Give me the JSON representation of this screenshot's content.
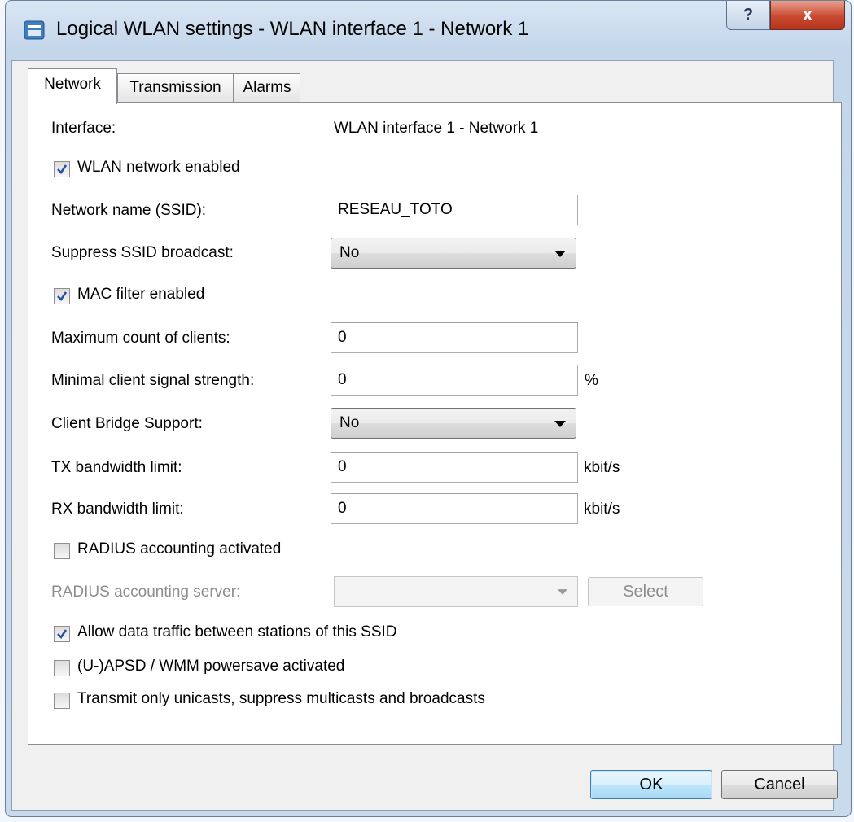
{
  "window": {
    "title": "Logical WLAN settings - WLAN interface 1 - Network 1",
    "help_label": "?",
    "close_label": "x"
  },
  "tabs": [
    {
      "label": "Network",
      "active": true
    },
    {
      "label": "Transmission",
      "active": false
    },
    {
      "label": "Alarms",
      "active": false
    }
  ],
  "network": {
    "interface_label": "Interface:",
    "interface_value": "WLAN interface 1 - Network 1",
    "wlan_enabled_label": "WLAN network enabled",
    "wlan_enabled_checked": true,
    "ssid_label": "Network name (SSID):",
    "ssid_value": "RESEAU_TOTO",
    "suppress_label": "Suppress SSID broadcast:",
    "suppress_value": "No",
    "mac_filter_label": "MAC filter enabled",
    "mac_filter_checked": true,
    "max_clients_label": "Maximum count of clients:",
    "max_clients_value": "0",
    "min_signal_label": "Minimal client signal strength:",
    "min_signal_value": "0",
    "min_signal_unit": "%",
    "bridge_label": "Client Bridge Support:",
    "bridge_value": "No",
    "tx_label": "TX bandwidth limit:",
    "tx_value": "0",
    "tx_unit": "kbit/s",
    "rx_label": "RX bandwidth limit:",
    "rx_value": "0",
    "rx_unit": "kbit/s",
    "radius_acct_label": "RADIUS accounting activated",
    "radius_acct_checked": false,
    "radius_server_label": "RADIUS accounting server:",
    "radius_server_value": "",
    "select_label": "Select",
    "allow_traffic_label": "Allow data traffic between stations of this SSID",
    "allow_traffic_checked": true,
    "apsd_label": "(U-)APSD / WMM powersave activated",
    "apsd_checked": false,
    "unicast_label": "Transmit only unicasts, suppress multicasts and broadcasts",
    "unicast_checked": false
  },
  "footer": {
    "ok_label": "OK",
    "cancel_label": "Cancel"
  }
}
